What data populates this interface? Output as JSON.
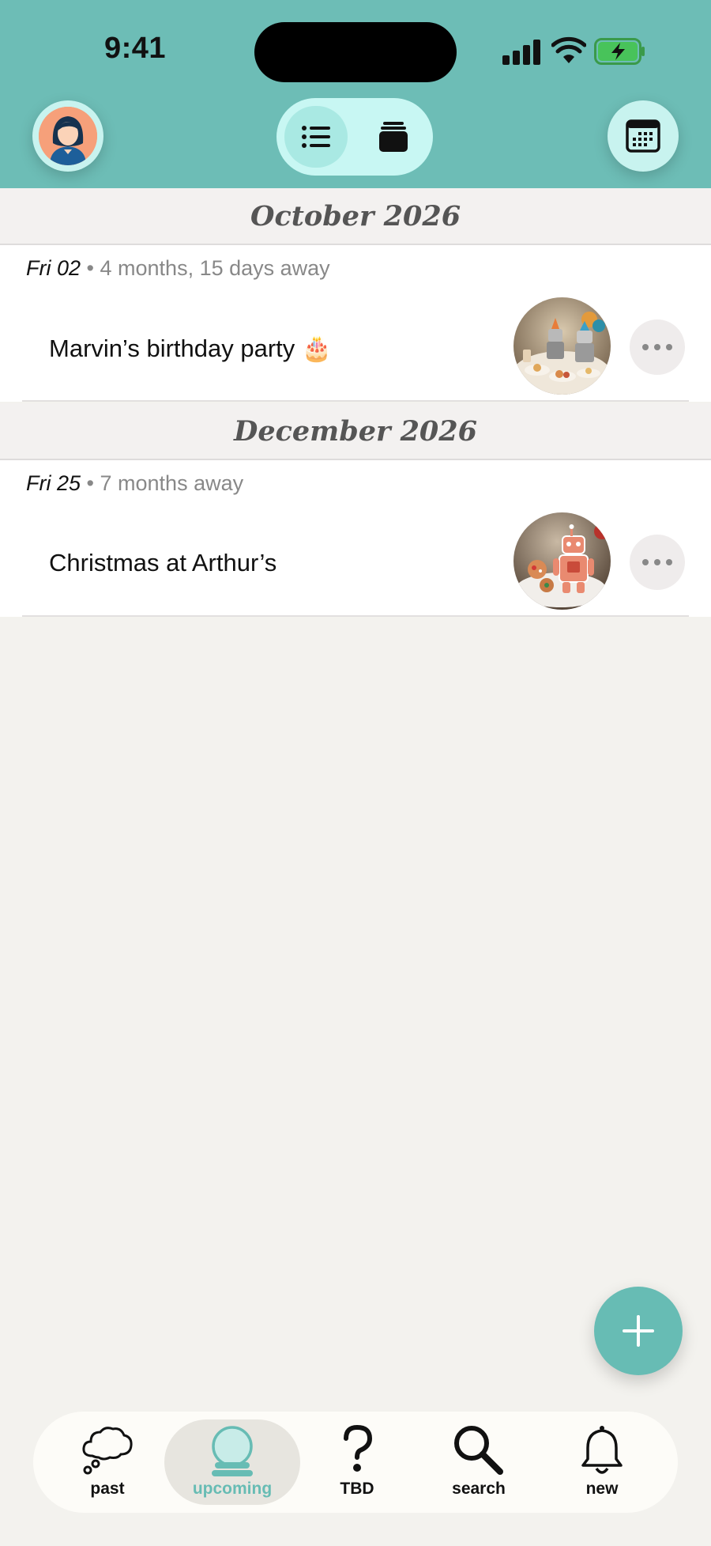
{
  "status_bar": {
    "time": "9:41"
  },
  "header": {
    "avatar_icon": "woman-avatar-icon",
    "view_toggle": {
      "active": "list",
      "options": [
        "list-icon",
        "stack-icon"
      ]
    },
    "calendar_icon": "calendar-icon"
  },
  "months": [
    {
      "label": "October 2026",
      "events": [
        {
          "day": "Fri 02",
          "relative": "4 months, 15 days away",
          "title": "Marvin’s birthday party 🎂",
          "photo": "robot-birthday-party-photo"
        }
      ]
    },
    {
      "label": "December 2026",
      "events": [
        {
          "day": "Fri 25",
          "relative": "7 months away",
          "title": "Christmas at Arthur’s",
          "photo": "robot-gingerbread-cookie-photo"
        }
      ]
    }
  ],
  "fab": {
    "icon": "plus-icon"
  },
  "tabs": [
    {
      "label": "past",
      "icon": "thought-cloud-icon"
    },
    {
      "label": "upcoming",
      "icon": "crystal-ball-icon",
      "active": true
    },
    {
      "label": "TBD",
      "icon": "question-mark-icon"
    },
    {
      "label": "search",
      "icon": "search-icon"
    },
    {
      "label": "new",
      "icon": "bell-icon"
    }
  ],
  "colors": {
    "header": "#6dbdb6",
    "accent": "#67bcb4",
    "background": "#f3f2ee"
  }
}
